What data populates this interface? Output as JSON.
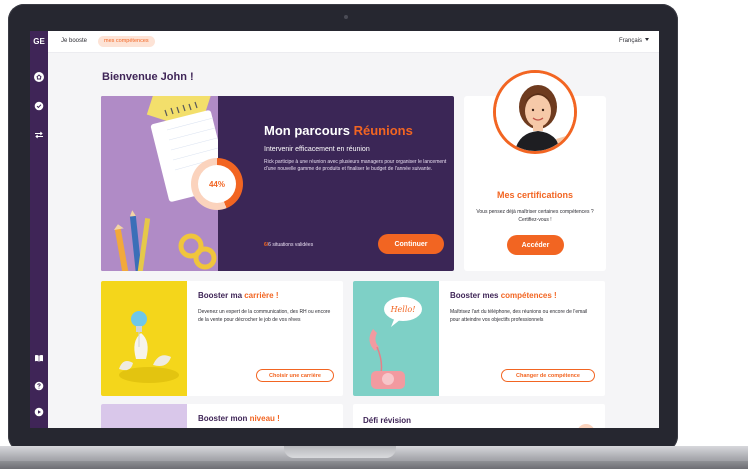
{
  "app": {
    "logo": "GE",
    "breadcrumb": "Je booste",
    "breadcrumb_pill": "mes compétences",
    "language": "Français"
  },
  "welcome": "Bienvenue John !",
  "parcours": {
    "title": "Mon parcours ",
    "title_accent": "Réunions",
    "subtitle": "Intervenir efficacement en réunion",
    "description": "Rick participe à une réunion avec plusieurs managers pour organiser le lancement d'une nouvelle gamme de produits et finaliser le budget de l'année suivante.",
    "progress_label": "44%",
    "progress": 0.44,
    "count_done": "6/",
    "count_total": "6",
    "count_label": " situations validées",
    "button": "Continuer"
  },
  "certifications": {
    "title": "Mes certifications",
    "description": "Vous pensez déjà maîtriser certaines compétences ? Certifiez-vous !",
    "button": "Accéder"
  },
  "carriere": {
    "title": "Booster ma ",
    "title_accent": "carrière !",
    "description": "Devenez un expert de la communication, des RH ou encore de la vente pour décrocher le job de vos rêves",
    "button": "Choisir une carrière"
  },
  "competences": {
    "title": "Booster mes ",
    "title_accent": "compétences !",
    "description": "Maîtrisez l'art du téléphone, des réunions ou encore de l'email pour atteindre vos objectifs professionnels",
    "button": "Changer de compétence",
    "bubble": "Hello!"
  },
  "niveau": {
    "title": "Booster mon ",
    "title_accent": "niveau !"
  },
  "revision": {
    "title": "Défi révision"
  },
  "colors": {
    "brand_purple": "#3f2557",
    "accent_orange": "#f26522"
  },
  "icons": [
    "home-icon",
    "check-badge-icon",
    "swap-arrows-icon",
    "book-icon",
    "help-icon",
    "play-icon"
  ]
}
